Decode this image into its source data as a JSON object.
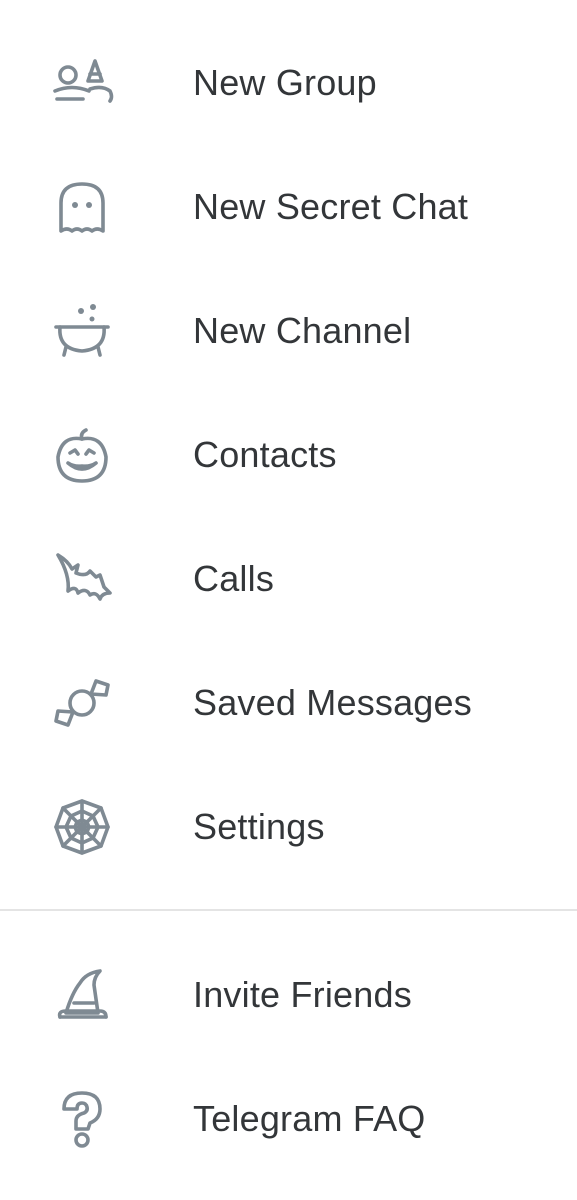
{
  "menu": {
    "items": [
      {
        "label": "New Group",
        "icon": "witch-group-icon"
      },
      {
        "label": "New Secret Chat",
        "icon": "ghost-icon"
      },
      {
        "label": "New Channel",
        "icon": "cauldron-icon"
      },
      {
        "label": "Contacts",
        "icon": "pumpkin-icon"
      },
      {
        "label": "Calls",
        "icon": "bat-icon"
      },
      {
        "label": "Saved Messages",
        "icon": "candy-icon"
      },
      {
        "label": "Settings",
        "icon": "spider-web-icon"
      },
      {
        "label": "Invite Friends",
        "icon": "witch-hat-icon"
      },
      {
        "label": "Telegram FAQ",
        "icon": "question-mark-icon"
      }
    ]
  },
  "colors": {
    "icon": "#7f8a93",
    "text": "#333639",
    "divider": "#e4e4e4",
    "background": "#ffffff"
  }
}
